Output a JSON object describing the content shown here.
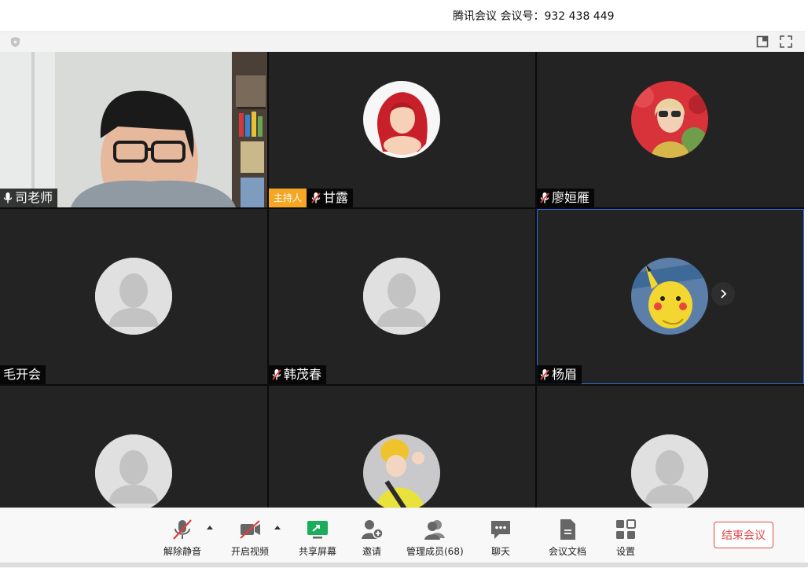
{
  "title": {
    "app_name": "腾讯会议",
    "meeting_id_label": "会议号：",
    "meeting_id": "932 438 449"
  },
  "participants": [
    {
      "name": "司老师",
      "muted": false,
      "host": false,
      "avatar": "camera-video"
    },
    {
      "name": "甘露",
      "muted": true,
      "host": true,
      "host_label": "主持人",
      "avatar": "mermaid-avatar"
    },
    {
      "name": "廖姮雁",
      "muted": true,
      "host": false,
      "avatar": "sunglasses-avatar"
    },
    {
      "name": "毛开会",
      "muted": false,
      "host": false,
      "avatar": "default-avatar"
    },
    {
      "name": "韩茂春",
      "muted": true,
      "host": false,
      "avatar": "default-avatar"
    },
    {
      "name": "杨眉",
      "muted": true,
      "host": false,
      "avatar": "pikachu-avatar",
      "selected": true
    },
    {
      "name": "",
      "avatar": "default-avatar"
    },
    {
      "name": "",
      "avatar": "yellow-hat-avatar"
    },
    {
      "name": "",
      "avatar": "default-avatar"
    }
  ],
  "toolbar": {
    "unmute": "解除静音",
    "start_video": "开启视频",
    "share_screen": "共享屏幕",
    "invite": "邀请",
    "manage_members": "管理成员(68)",
    "chat": "聊天",
    "documents": "会议文档",
    "settings": "设置",
    "end_meeting": "结束会议"
  },
  "colors": {
    "host_badge": "#f5a623",
    "end_button": "#e24a4a",
    "share_green": "#1aad5a",
    "selected_border": "#2f6fe0"
  }
}
